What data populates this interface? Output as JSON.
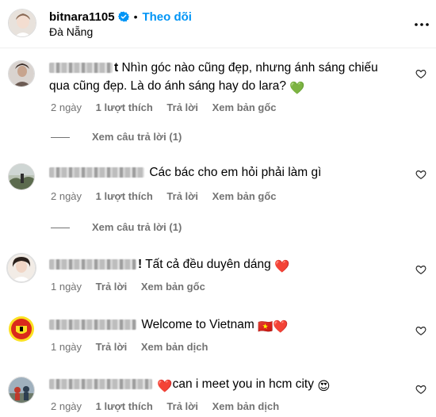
{
  "header": {
    "username": "bitnara1105",
    "separator": "•",
    "follow_label": "Theo dõi",
    "location": "Đà Nẵng",
    "more_icon": "more-icon"
  },
  "comments": [
    {
      "username_visible": "t",
      "text_line1": "Nhìn góc nào cũng đẹp, nhưng ánh sáng chiếu",
      "text_line2": "qua cũng đẹp. Là do ánh sáng hay do lara?",
      "emoji": "💚",
      "time": "2 ngày",
      "likes": "1 lượt thích",
      "reply": "Trả lời",
      "action": "Xem bản gốc",
      "view_replies": "Xem câu trả lời (1)"
    },
    {
      "username_visible": "",
      "text_line1": "Các bác cho em hỏi phải làm gì",
      "time": "2 ngày",
      "likes": "1 lượt thích",
      "reply": "Trả lời",
      "action": "Xem bản gốc",
      "view_replies": "Xem câu trả lời (1)"
    },
    {
      "username_visible": "!",
      "text_line1": "Tất cả đều duyên dáng",
      "emoji": "❤️",
      "time": "1 ngày",
      "reply": "Trả lời",
      "action": "Xem bản gốc"
    },
    {
      "username_visible": "",
      "text_line1": "Welcome to Vietnam",
      "emoji": "🇻🇳❤️",
      "time": "1 ngày",
      "reply": "Trả lời",
      "action": "Xem bản dịch"
    },
    {
      "username_visible": "",
      "text_line1": "can i meet you in hcm city",
      "emoji_prefix": "❤️",
      "emoji": "😍",
      "time": "2 ngày",
      "likes": "1 lượt thích",
      "reply": "Trả lời",
      "action": "Xem bản dịch"
    }
  ],
  "colors": {
    "follow": "#0095f6",
    "meta": "#737373",
    "verified": "#0095f6"
  }
}
